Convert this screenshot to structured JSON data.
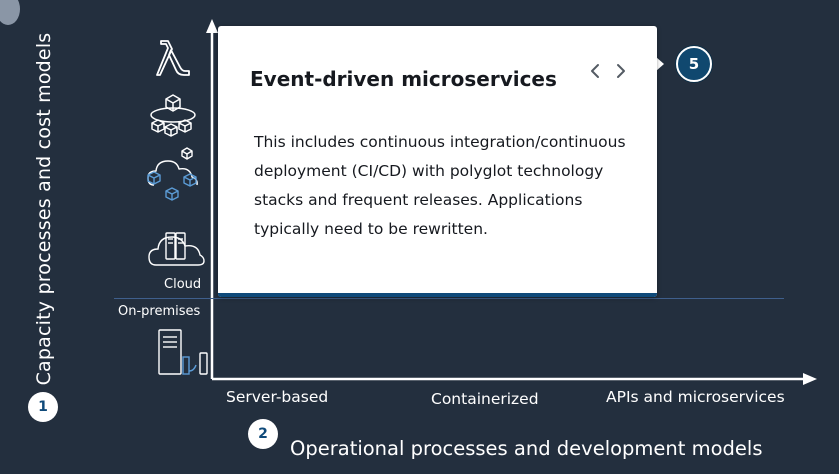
{
  "diagram": {
    "y_axis_label": "Capacity processes and cost models",
    "x_axis_label": "Operational processes and development models",
    "x_ticks": [
      "Server-based",
      "Containerized",
      "APIs and microservices"
    ],
    "region_labels": {
      "cloud": "Cloud",
      "on_premises": "On-premises"
    },
    "markers": {
      "y_marker": "1",
      "x_marker": "2",
      "active_marker": "5"
    },
    "icons": [
      "lambda-icon",
      "container-cluster-icon",
      "cloud-network-icon",
      "cloud-server-icon",
      "on-premises-server-icon"
    ]
  },
  "popover": {
    "title": "Event-driven microservices",
    "body": "This includes continuous integration/continuous deployment (CI/CD) with polyglot technology stacks and frequent releases. Applications typically need to be rewritten.",
    "prev_icon": "chevron-left-icon",
    "next_icon": "chevron-right-icon"
  },
  "colors": {
    "background": "#232f3e",
    "accent": "#0f4a7a",
    "divider": "#3f5f8c",
    "card": "#ffffff"
  }
}
